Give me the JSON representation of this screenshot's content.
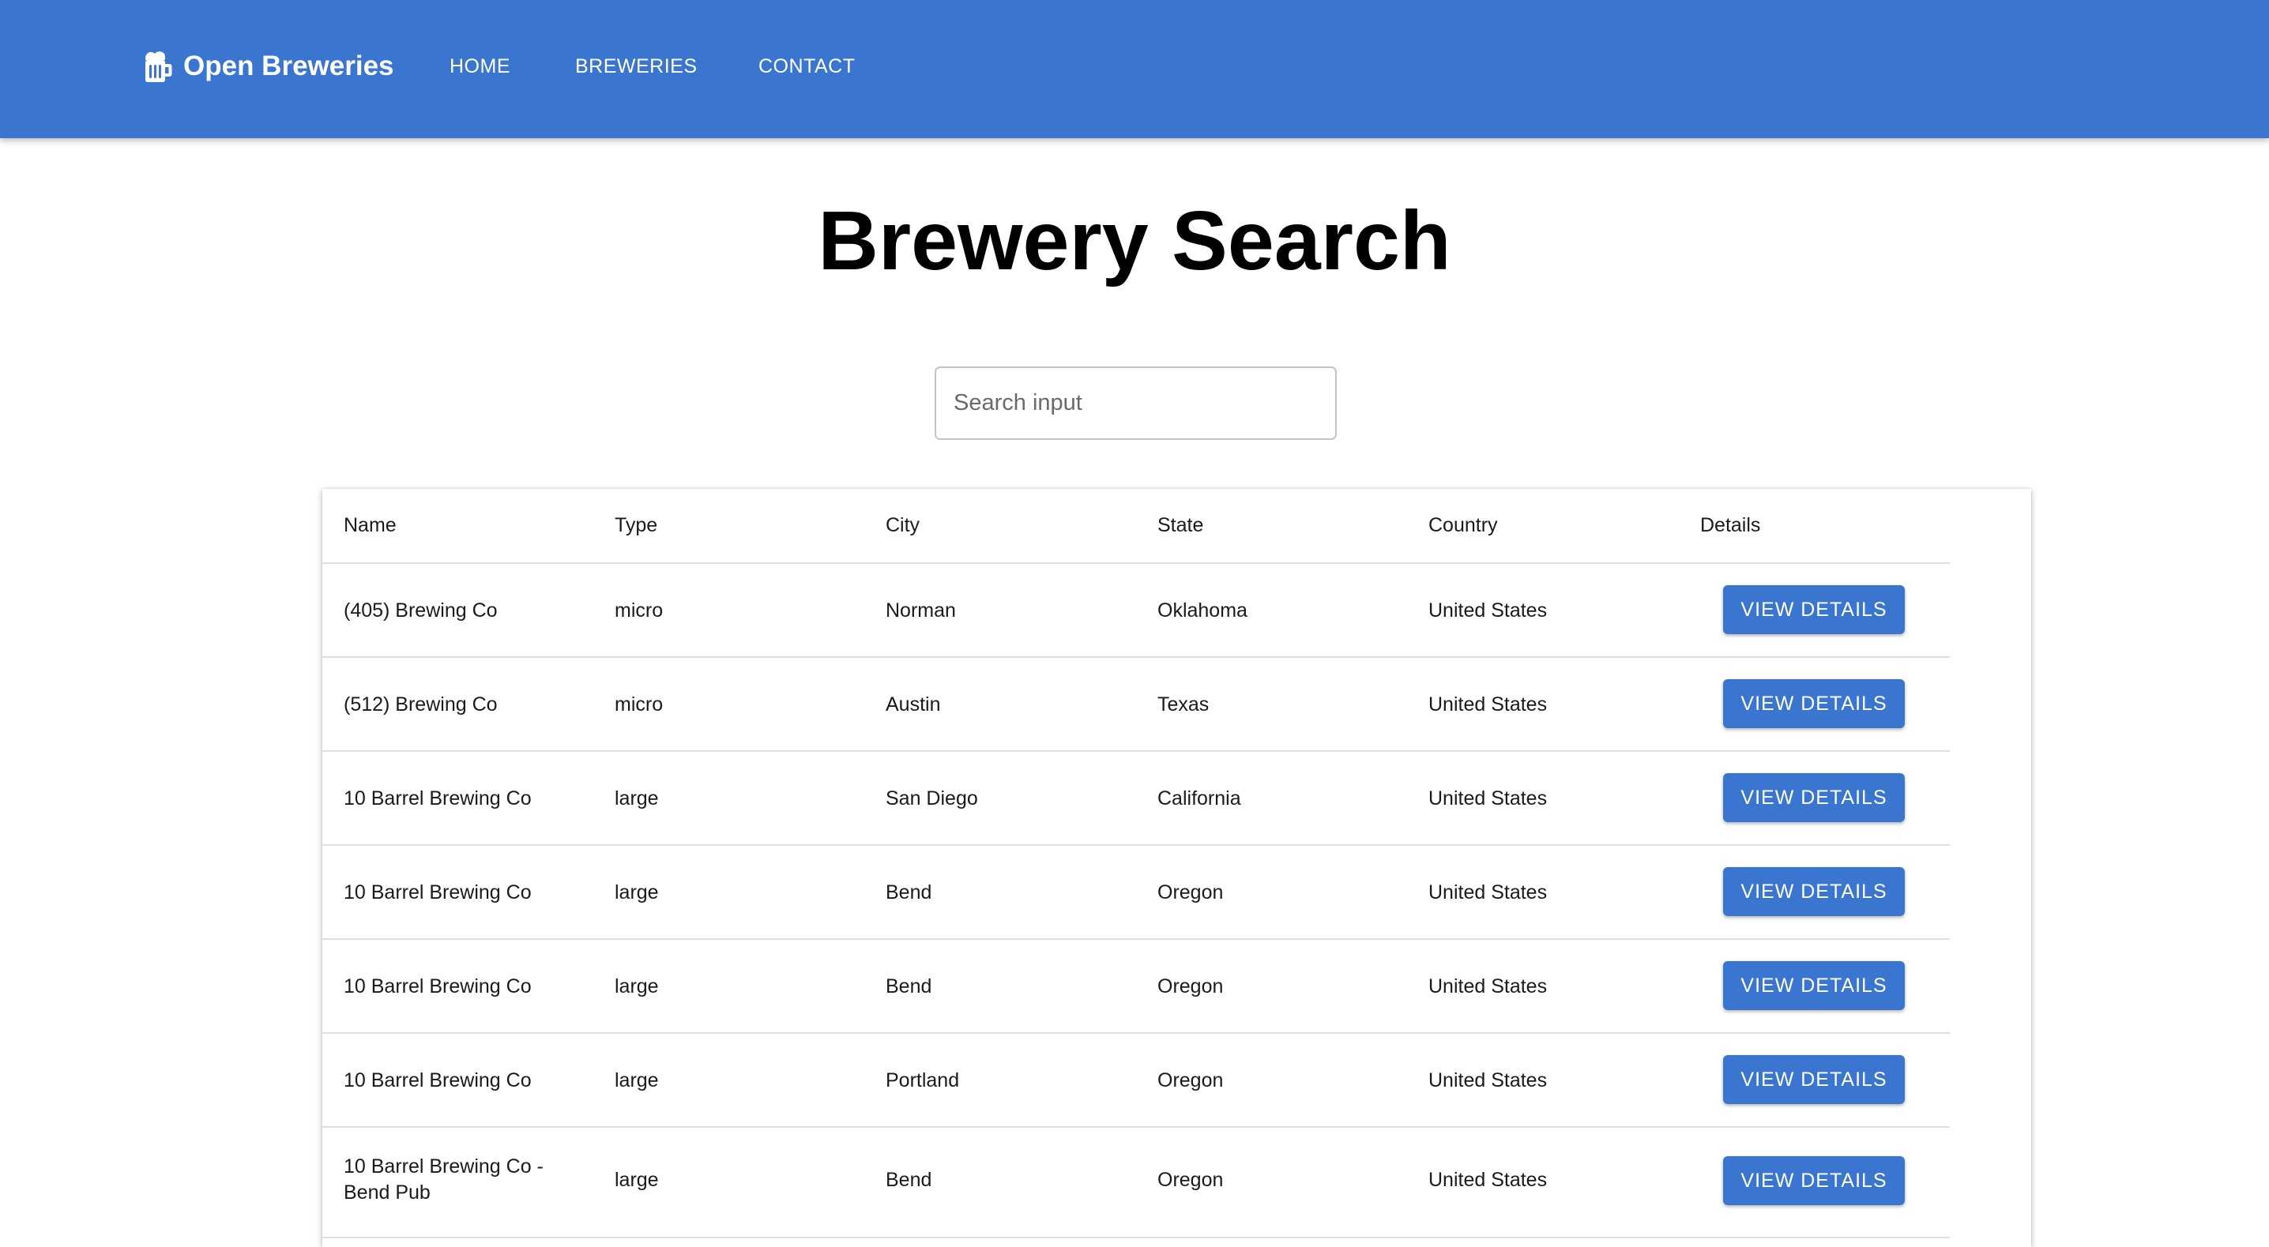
{
  "appbar": {
    "brand_name": "Open Breweries",
    "brand_icon": "beer-mug-icon",
    "nav": [
      {
        "label": "HOME"
      },
      {
        "label": "BREWERIES"
      },
      {
        "label": "CONTACT"
      }
    ],
    "color": "#3a75cf"
  },
  "page": {
    "title": "Brewery Search"
  },
  "search": {
    "placeholder": "Search input",
    "value": ""
  },
  "table": {
    "headers": {
      "name": "Name",
      "type": "Type",
      "city": "City",
      "state": "State",
      "country": "Country",
      "details": "Details"
    },
    "button_label": "VIEW DETAILS",
    "rows": [
      {
        "name": "(405) Brewing Co",
        "type": "micro",
        "city": "Norman",
        "state": "Oklahoma",
        "country": "United States"
      },
      {
        "name": "(512) Brewing Co",
        "type": "micro",
        "city": "Austin",
        "state": "Texas",
        "country": "United States"
      },
      {
        "name": "10 Barrel Brewing Co",
        "type": "large",
        "city": "San Diego",
        "state": "California",
        "country": "United States"
      },
      {
        "name": "10 Barrel Brewing Co",
        "type": "large",
        "city": "Bend",
        "state": "Oregon",
        "country": "United States"
      },
      {
        "name": "10 Barrel Brewing Co",
        "type": "large",
        "city": "Bend",
        "state": "Oregon",
        "country": "United States"
      },
      {
        "name": "10 Barrel Brewing Co",
        "type": "large",
        "city": "Portland",
        "state": "Oregon",
        "country": "United States"
      },
      {
        "name": "10 Barrel Brewing Co - Bend Pub",
        "type": "large",
        "city": "Bend",
        "state": "Oregon",
        "country": "United States"
      }
    ]
  }
}
